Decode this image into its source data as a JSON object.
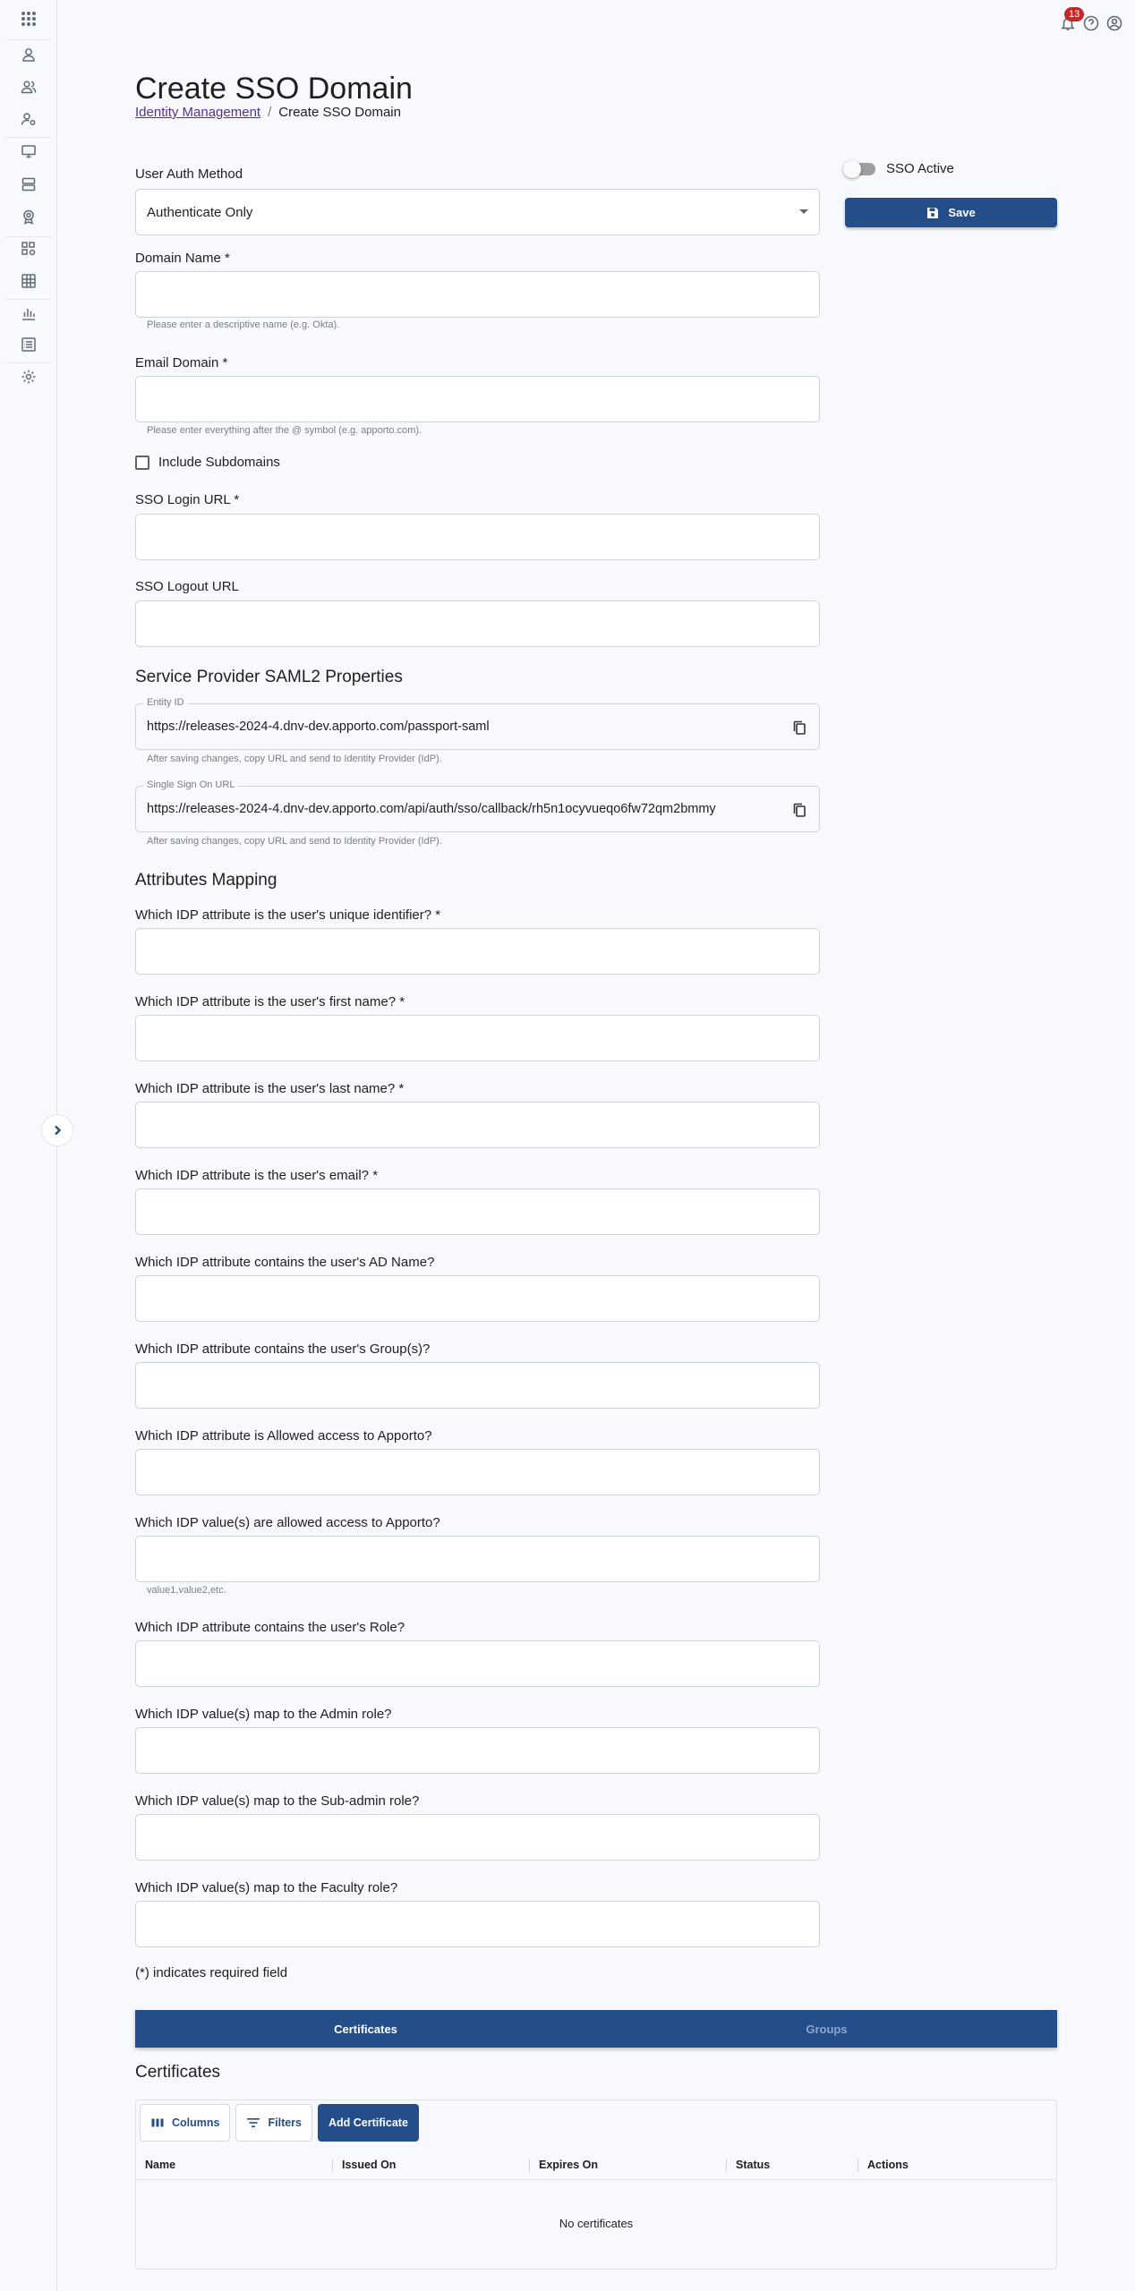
{
  "header": {
    "notifications_count": "13"
  },
  "page": {
    "title": "Create SSO Domain",
    "breadcrumb": {
      "parent": "Identity Management",
      "separator": "/",
      "current": "Create SSO Domain"
    }
  },
  "right_panel": {
    "toggle_label": "SSO Active",
    "toggle_on": false,
    "save_label": "Save"
  },
  "form": {
    "auth_method_label": "User Auth Method",
    "auth_method_value": "Authenticate Only",
    "domain_name_label": "Domain Name *",
    "domain_name_helper": "Please enter a descriptive name (e.g. Okta).",
    "email_domain_label": "Email Domain *",
    "email_domain_helper": "Please enter everything after the @ symbol (e.g. apporto.com).",
    "include_subdomains_label": "Include Subdomains",
    "sso_login_label": "SSO Login URL *",
    "sso_logout_label": "SSO Logout URL",
    "sp_section_title": "Service Provider SAML2 Properties",
    "entity_id_legend": "Entity ID",
    "entity_id_value": "https://releases-2024-4.dnv-dev.apporto.com/passport-saml",
    "entity_id_helper": "After saving changes, copy URL and send to Identity Provider (IdP).",
    "sso_url_legend": "Single Sign On URL",
    "sso_url_value": "https://releases-2024-4.dnv-dev.apporto.com/api/auth/sso/callback/rh5n1ocyvueqo6fw72qm2bmmy",
    "sso_url_helper": "After saving changes, copy URL and send to Identity Provider (IdP).",
    "attributes_title": "Attributes Mapping",
    "attr_unique_label": "Which IDP attribute is the user's unique identifier? *",
    "attr_first_label": "Which IDP attribute is the user's first name? *",
    "attr_last_label": "Which IDP attribute is the user's last name? *",
    "attr_email_label": "Which IDP attribute is the user's email? *",
    "attr_adname_label": "Which IDP attribute contains the user's AD Name?",
    "attr_groups_label": "Which IDP attribute contains the user's Group(s)?",
    "attr_allowed_label": "Which IDP attribute is Allowed access to Apporto?",
    "attr_allowed_values_label": "Which IDP value(s) are allowed access to Apporto?",
    "attr_allowed_values_helper": "value1,value2,etc.",
    "attr_role_label": "Which IDP attribute contains the user's Role?",
    "attr_admin_label": "Which IDP value(s) map to the Admin role?",
    "attr_subadmin_label": "Which IDP value(s) map to the Sub-admin role?",
    "attr_faculty_label": "Which IDP value(s) map to the Faculty role?",
    "required_note": "(*) indicates required field"
  },
  "tabs": [
    "Certificates",
    "Groups"
  ],
  "certificates": {
    "title": "Certificates",
    "columns_label": "Columns",
    "filters_label": "Filters",
    "add_label": "Add Certificate",
    "headers": [
      "Name",
      "Issued On",
      "Expires On",
      "Status",
      "Actions"
    ],
    "empty_text": "No certificates"
  }
}
